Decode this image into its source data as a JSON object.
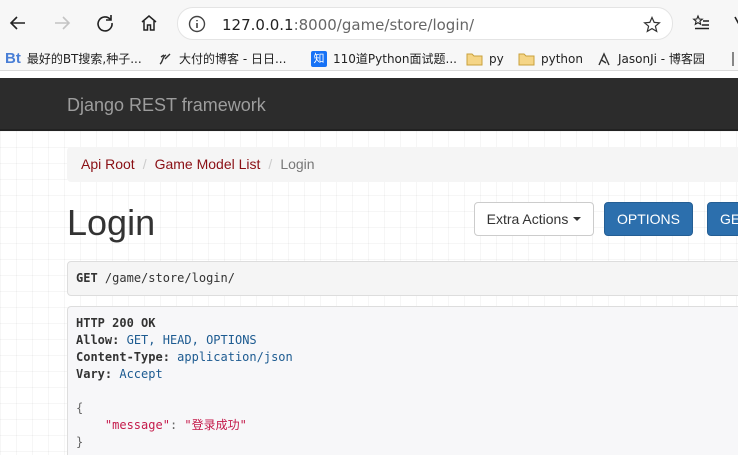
{
  "browser": {
    "url_host": "127.0.0.1",
    "url_rest": ":8000/game/store/login/",
    "bookmarks": [
      {
        "label": "最好的BT搜索,种子...",
        "icon": "bt-icon"
      },
      {
        "label": "大付的博客 - 日日...",
        "icon": "blog-icon"
      },
      {
        "label": "110道Python面试题...",
        "icon": "zhihu-icon"
      },
      {
        "label": "py",
        "icon": "folder-icon"
      },
      {
        "label": "python",
        "icon": "folder-icon"
      },
      {
        "label": "JasonJi - 博客园",
        "icon": "cnblogs-icon"
      }
    ],
    "bt_icon_text": "Bt",
    "zhihu_icon_text": "知"
  },
  "navbar": {
    "brand": "Django REST framework"
  },
  "breadcrumb": {
    "api_root": "Api Root",
    "list": "Game Model List",
    "current": "Login",
    "separator": "/"
  },
  "page": {
    "title": "Login"
  },
  "buttons": {
    "extra_actions": "Extra Actions",
    "options": "OPTIONS",
    "get": "GET"
  },
  "request": {
    "method": "GET",
    "path": "/game/store/login/"
  },
  "response": {
    "status_line": "HTTP 200 OK",
    "headers": [
      {
        "name": "Allow:",
        "value": "GET, HEAD, OPTIONS"
      },
      {
        "name": "Content-Type:",
        "value": "application/json"
      },
      {
        "name": "Vary:",
        "value": "Accept"
      }
    ],
    "json_open": "{",
    "json_key": "\"message\"",
    "json_colon": ":",
    "json_value": "\"登录成功\"",
    "json_close": "}"
  }
}
